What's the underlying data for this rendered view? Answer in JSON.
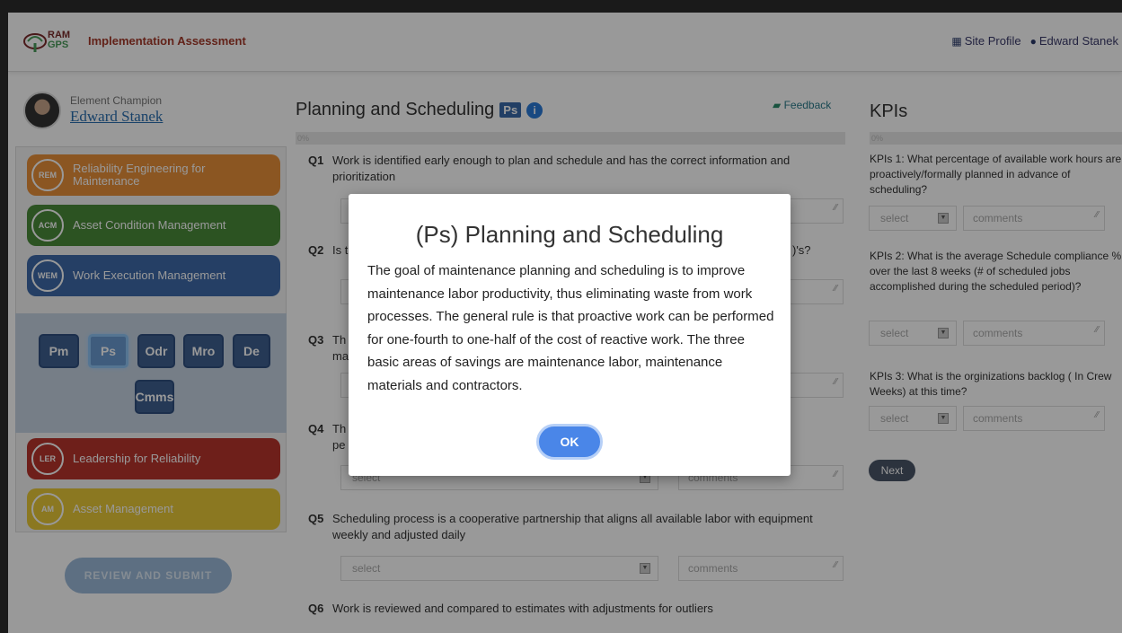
{
  "header": {
    "logo_text": [
      "RAM",
      "GPS"
    ],
    "title": "Implementation Assessment",
    "site_profile": "Site Profile",
    "user_name": "Edward Stanek"
  },
  "champion": {
    "role": "Element Champion",
    "name": "Edward Stanek"
  },
  "elements": [
    {
      "badge": "REM",
      "label": "Reliability Engineering for Maintenance",
      "color": "#e8903a"
    },
    {
      "badge": "ACM",
      "label": "Asset Condition Management",
      "color": "#4a8a3a"
    },
    {
      "badge": "WEM",
      "label": "Work Execution Management",
      "color": "#3f6aa8"
    },
    {
      "badge": "LER",
      "label": "Leadership for Reliability",
      "color": "#b8342c"
    },
    {
      "badge": "AM",
      "label": "Asset Management",
      "color": "#e8c838"
    }
  ],
  "sub_elements": [
    "Pm",
    "Ps",
    "Odr",
    "Mro",
    "De",
    "Cmms"
  ],
  "review_button": "REVIEW AND SUBMIT",
  "section": {
    "title": "Planning and Scheduling",
    "tag": "Ps",
    "info": "i",
    "feedback": "Feedback",
    "progress": "0%"
  },
  "questions": [
    {
      "num": "Q1",
      "text": "Work is identified early enough to plan and schedule and has the correct information and prioritization"
    },
    {
      "num": "Q2",
      "text": "Is t",
      "text_end": ")'s?"
    },
    {
      "num": "Q3",
      "text": "Th",
      "text2": "ma"
    },
    {
      "num": "Q4",
      "text": "Th",
      "text2": "pe"
    },
    {
      "num": "Q5",
      "text": "Scheduling process is a cooperative partnership that aligns all available labor with equipment  weekly and adjusted daily"
    },
    {
      "num": "Q6",
      "text": "Work is reviewed and compared to estimates with adjustments for outliers"
    }
  ],
  "select_placeholder": "select",
  "comments_placeholder": "comments",
  "kpis": {
    "title": "KPIs",
    "progress": "0%",
    "items": [
      {
        "q1": "KPIs 1: What percentage of available work hours are proactively/formally planned in advance of scheduling?"
      },
      {
        "q2": "KPIs 2: What is the average Schedule compliance % over the last 8 weeks (# of scheduled jobs accomplished during the scheduled period)?"
      },
      {
        "q3": "KPIs 3: What is the orginizations backlog ( In Crew Weeks) at this time?"
      }
    ],
    "next": "Next"
  },
  "modal": {
    "title": "(Ps) Planning and Scheduling",
    "body": "The goal of maintenance planning and scheduling is to improve maintenance labor productivity, thus eliminating waste from work processes. The general rule is that proactive work can be performed for one-fourth to one-half of the cost of reactive work. The three basic areas of savings are maintenance labor, maintenance materials and contractors.",
    "ok": "OK"
  }
}
